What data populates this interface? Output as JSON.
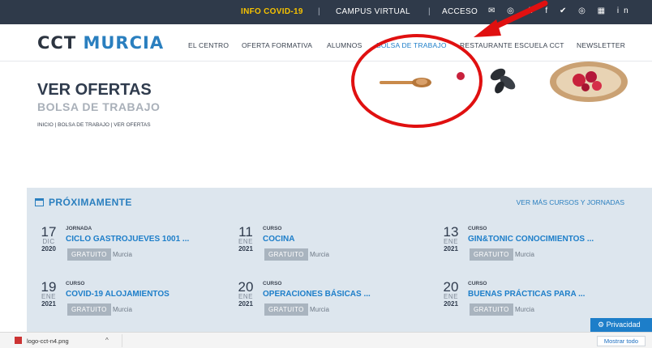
{
  "topbar": {
    "covid": "INFO COVID-19",
    "sep": "|",
    "campus": "CAMPUS VIRTUAL",
    "acceso": "ACCESO",
    "social_icons": "✉ ◎ ♟ f ✔ ◎ ▦ in"
  },
  "header": {
    "logo_a": "CCT",
    "logo_b": "MURCIA",
    "nav": [
      "EL CENTRO",
      "OFERTA FORMATIVA",
      "ALUMNOS",
      "BOLSA DE TRABAJO",
      "RESTAURANTE ESCUELA CCT",
      "NEWSLETTER"
    ]
  },
  "page": {
    "title": "VER OFERTAS",
    "subtitle": "BOLSA DE TRABAJO",
    "breadcrumb": "INICIO  |  BOLSA DE TRABAJO  |  VER OFERTAS"
  },
  "upcoming": {
    "heading": "PRÓXIMAMENTE",
    "more": "VER MÁS CURSOS Y JORNADAS",
    "events": [
      {
        "day": "17",
        "month": "DIC",
        "year": "2020",
        "type": "JORNADA",
        "name": "CICLO GASTROJUEVES 1001 ...",
        "badge": "GRATUITO",
        "city": "Murcia"
      },
      {
        "day": "11",
        "month": "ENE",
        "year": "2021",
        "type": "CURSO",
        "name": "COCINA",
        "badge": "GRATUITO",
        "city": "Murcia"
      },
      {
        "day": "13",
        "month": "ENE",
        "year": "2021",
        "type": "CURSO",
        "name": "GIN&TONIC CONOCIMIENTOS ...",
        "badge": "GRATUITO",
        "city": "Murcia"
      },
      {
        "day": "19",
        "month": "ENE",
        "year": "2021",
        "type": "CURSO",
        "name": "COVID-19 ALOJAMIENTOS",
        "badge": "GRATUITO",
        "city": "Murcia"
      },
      {
        "day": "20",
        "month": "ENE",
        "year": "2021",
        "type": "CURSO",
        "name": "OPERACIONES BÁSICAS ...",
        "badge": "GRATUITO",
        "city": "Murcia"
      },
      {
        "day": "20",
        "month": "ENE",
        "year": "2021",
        "type": "CURSO",
        "name": "BUENAS PRÁCTICAS PARA ...",
        "badge": "GRATUITO",
        "city": "Murcia"
      }
    ]
  },
  "privacy": "⚙ Privacidad",
  "downloads": {
    "file": "logo-cct-n4.png",
    "chevron": "^",
    "show_all": "Mostrar todo"
  },
  "colors": {
    "topbar": "#2f3a4a",
    "accent": "#1d7ec9",
    "covid": "#f6c200",
    "panel": "#dde6ee",
    "annotation": "#e01010"
  }
}
